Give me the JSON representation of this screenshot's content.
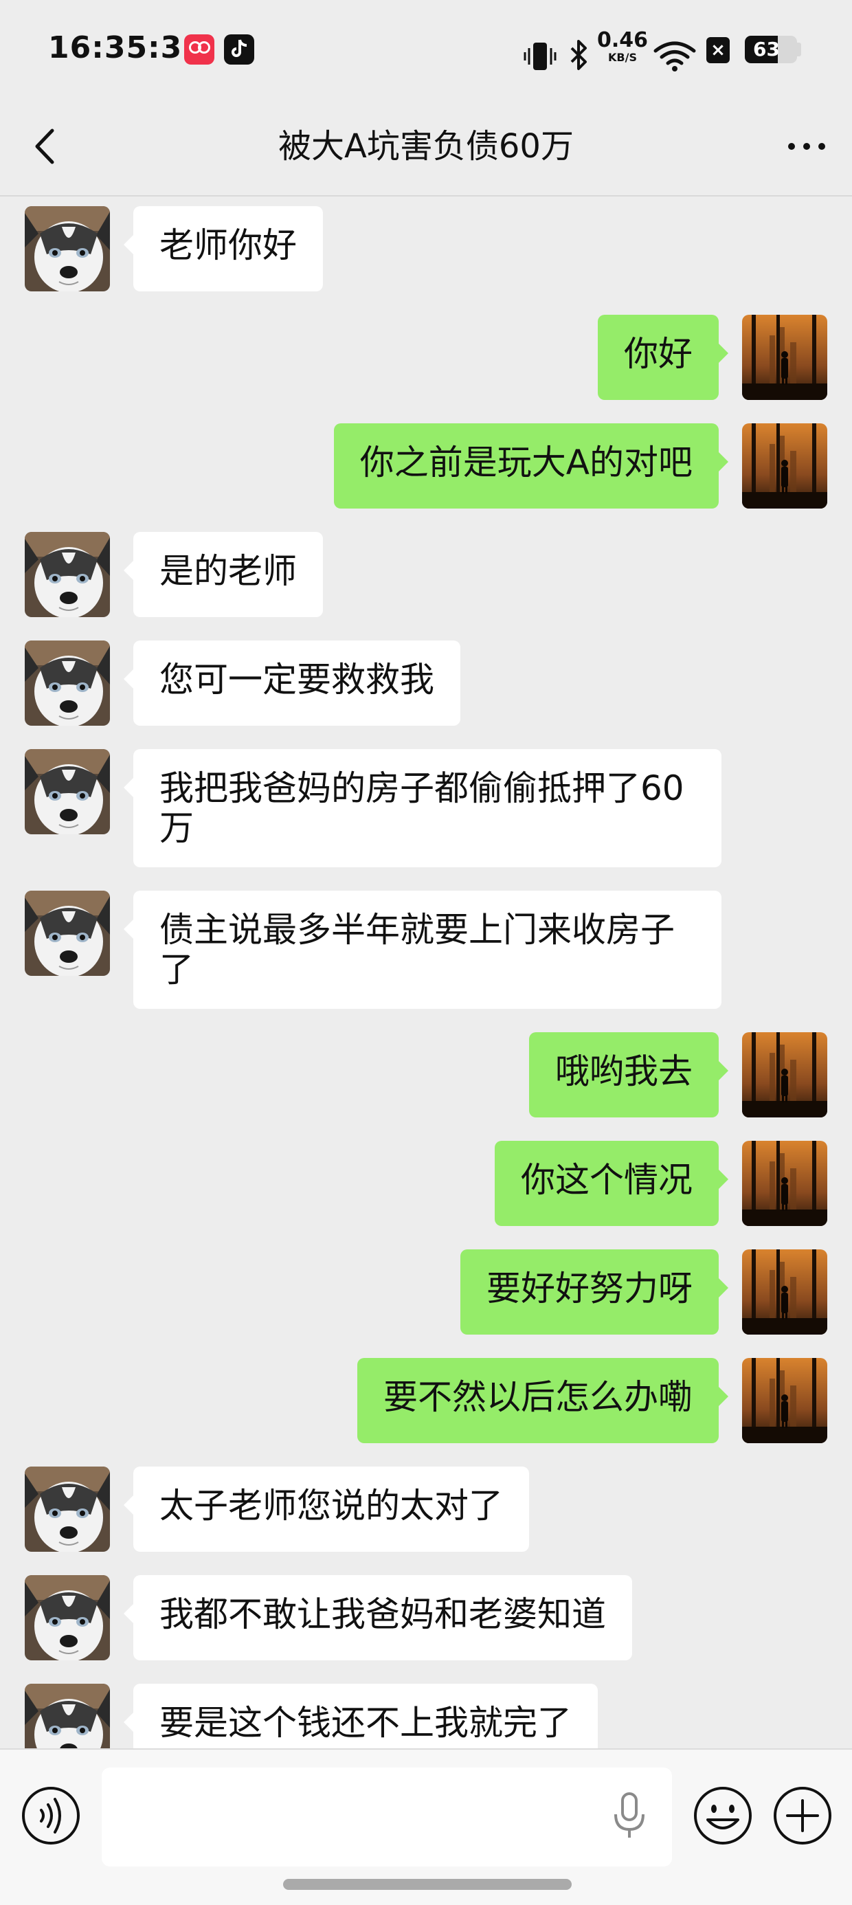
{
  "status_bar": {
    "time": "16:35:31",
    "app_icons": [
      "red-app-icon",
      "tiktok-icon"
    ],
    "indicators": [
      "vibrate-icon",
      "bluetooth-icon",
      "wifi-icon"
    ],
    "net_speed_value": "0.46",
    "net_speed_unit": "KB/S",
    "x_icon": "×",
    "battery_percent": "63",
    "battery_level": 0.63
  },
  "title_bar": {
    "title": "被大A坑害负债60万",
    "back_icon": "chevron-left-icon",
    "more_icon": "ellipsis-icon"
  },
  "messages": [
    {
      "side": "left",
      "text": "老师你好"
    },
    {
      "side": "right",
      "text": "你好"
    },
    {
      "side": "right",
      "text": "你之前是玩大A的对吧"
    },
    {
      "side": "left",
      "text": "是的老师"
    },
    {
      "side": "left",
      "text": "您可一定要救救我"
    },
    {
      "side": "left",
      "text": "我把我爸妈的房子都偷偷抵押了60万"
    },
    {
      "side": "left",
      "text": "债主说最多半年就要上门来收房子了"
    },
    {
      "side": "right",
      "text": "哦哟我去"
    },
    {
      "side": "right",
      "text": "你这个情况"
    },
    {
      "side": "right",
      "text": "要好好努力呀"
    },
    {
      "side": "right",
      "text": "要不然以后怎么办嘞"
    },
    {
      "side": "left",
      "text": "太子老师您说的太对了"
    },
    {
      "side": "left",
      "text": "我都不敢让我爸妈和老婆知道"
    },
    {
      "side": "left",
      "text": "要是这个钱还不上我就完了"
    }
  ],
  "input_bar": {
    "value": "",
    "placeholder": "",
    "icons": [
      "voice-icon",
      "microphone-icon",
      "emoji-icon",
      "plus-icon"
    ]
  },
  "colors": {
    "background": "#ededed",
    "self_bubble": "#95ec69",
    "other_bubble": "#ffffff"
  }
}
